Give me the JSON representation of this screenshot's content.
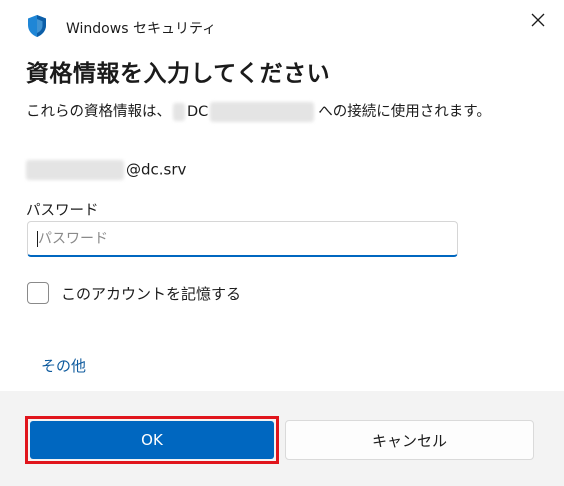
{
  "window": {
    "app_title": "Windows セキュリティ",
    "close_icon": "close-icon",
    "app_icon": "shield-icon"
  },
  "dialog": {
    "heading": "資格情報を入力してください",
    "description_prefix": "これらの資格情報は、",
    "description_server_prefix": "DC",
    "description_suffix": "への接続に使用されます。",
    "username_suffix": "@dc.srv",
    "password_label": "パスワード",
    "password_placeholder": "パスワード",
    "password_value": "",
    "remember_label": "このアカウントを記憶する",
    "remember_checked": false,
    "more_choices": "その他"
  },
  "buttons": {
    "ok": "OK",
    "cancel": "キャンセル"
  },
  "colors": {
    "accent": "#0067c0",
    "highlight_outline": "#e0141b",
    "link": "#0f5b9e",
    "footer_bg": "#f3f3f3"
  }
}
